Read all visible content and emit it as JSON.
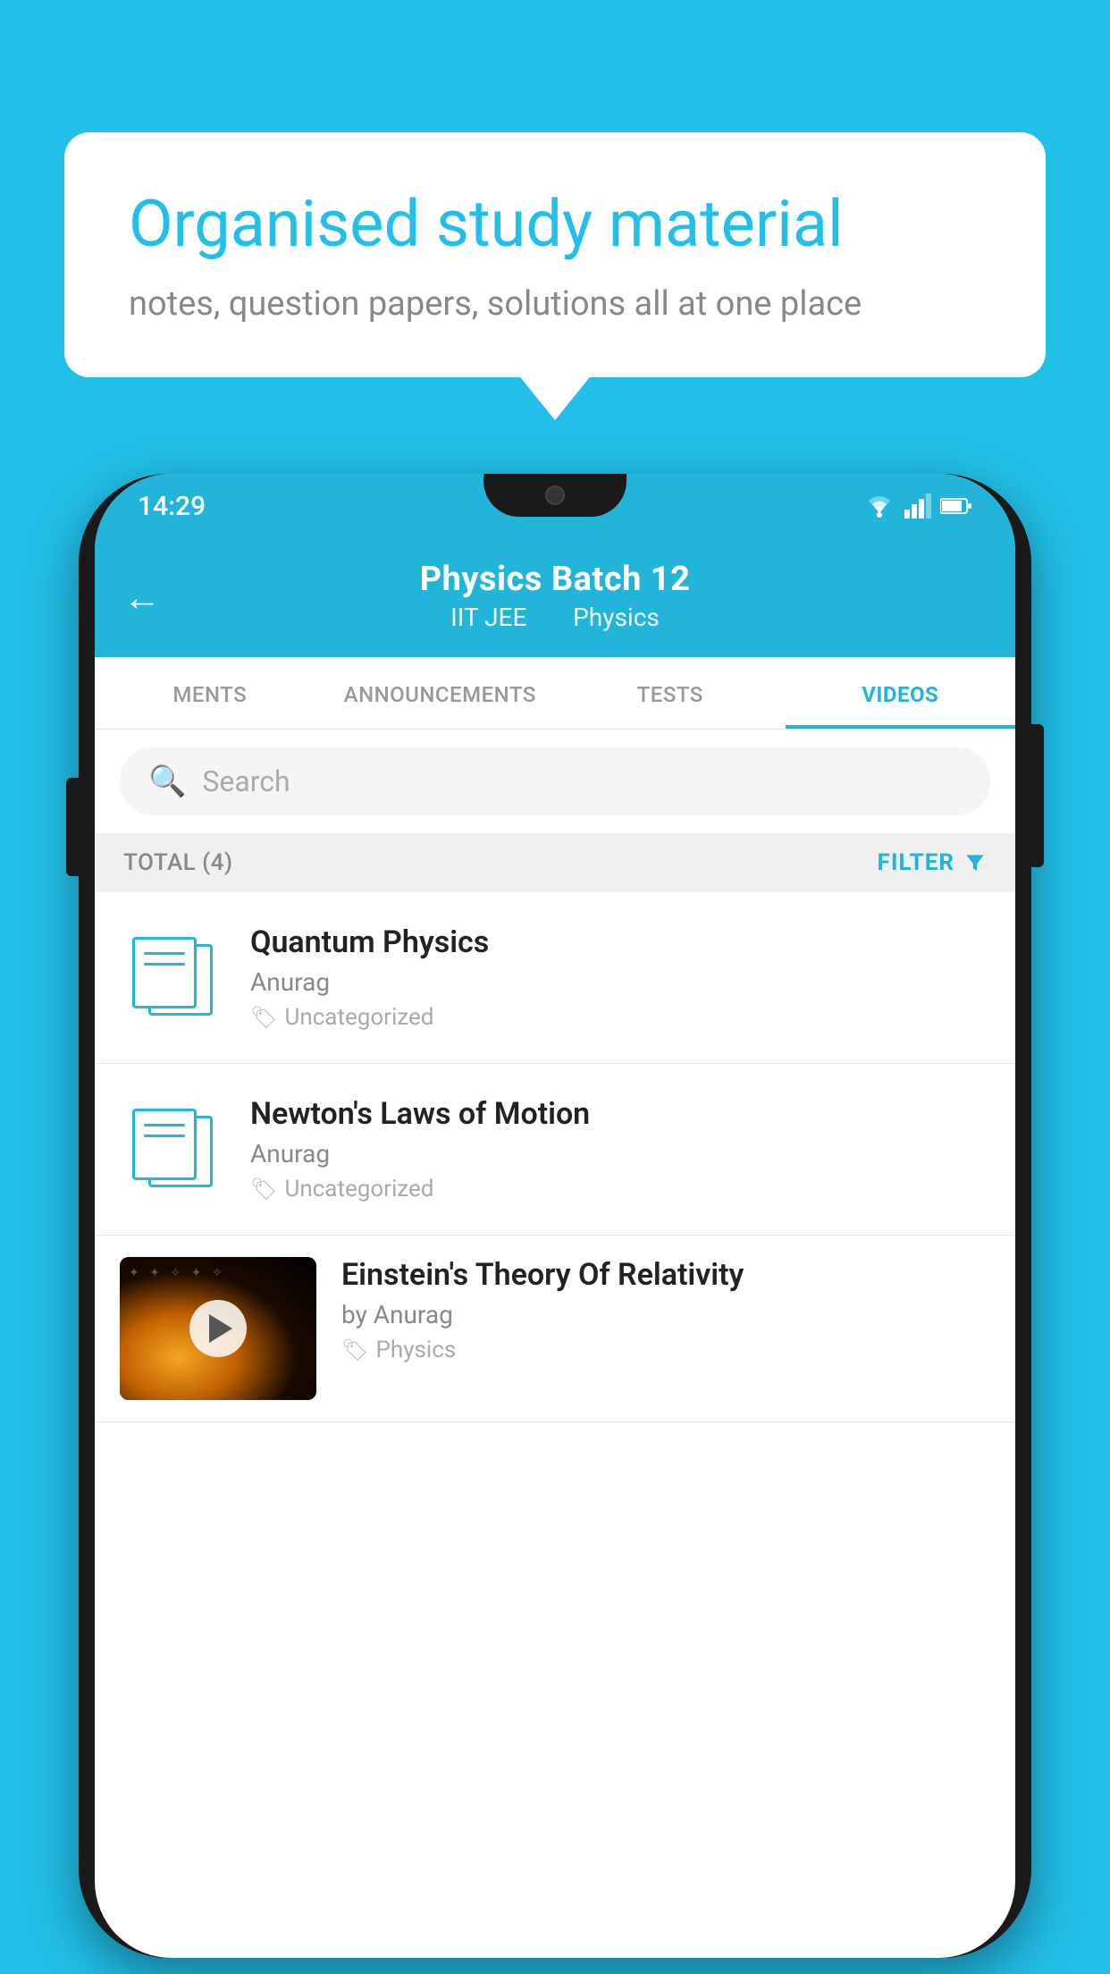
{
  "bubble": {
    "title": "Organised study material",
    "subtitle": "notes, question papers, solutions all at one place"
  },
  "statusBar": {
    "time": "14:29"
  },
  "header": {
    "title": "Physics Batch 12",
    "tag1": "IIT JEE",
    "tag2": "Physics"
  },
  "tabs": [
    {
      "label": "MENTS",
      "active": false
    },
    {
      "label": "ANNOUNCEMENTS",
      "active": false
    },
    {
      "label": "TESTS",
      "active": false
    },
    {
      "label": "VIDEOS",
      "active": true
    }
  ],
  "search": {
    "placeholder": "Search"
  },
  "filterBar": {
    "total": "TOTAL (4)",
    "filterLabel": "FILTER"
  },
  "videos": [
    {
      "title": "Quantum Physics",
      "author": "Anurag",
      "tag": "Uncategorized",
      "hasThumbnail": false
    },
    {
      "title": "Newton's Laws of Motion",
      "author": "Anurag",
      "tag": "Uncategorized",
      "hasThumbnail": false
    },
    {
      "title": "Einstein's Theory Of Relativity",
      "author": "by Anurag",
      "tag": "Physics",
      "hasThumbnail": true
    }
  ]
}
